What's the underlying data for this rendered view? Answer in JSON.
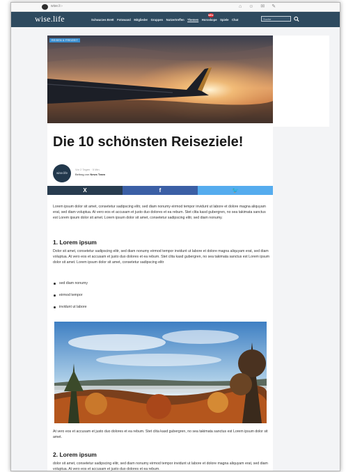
{
  "topbar": {
    "user": "wise.li ›"
  },
  "navbar": {
    "logo": "wise.life",
    "items": [
      {
        "label": "Schwarzes Brett"
      },
      {
        "label": "Fotowand"
      },
      {
        "label": "Mitglieder"
      },
      {
        "label": "Gruppen"
      },
      {
        "label": "Nutzertreffen"
      },
      {
        "label": "Themen"
      },
      {
        "label": "Horoskope"
      },
      {
        "label": "Spiele"
      },
      {
        "label": "Chat"
      }
    ],
    "active_item": "Themen",
    "badge": "NEU",
    "search_placeholder": "Suche"
  },
  "article": {
    "category": "REISEN & FREIZEIT",
    "title": "Die 10 schönsten Reiseziele!",
    "author": {
      "avatar_text": "wise.life",
      "meta": "Vor 2 Tagen · 5 Min.",
      "byline_prefix": "Beitrag von",
      "byline_name": "News Team"
    },
    "share": {
      "x": "X",
      "facebook": "f",
      "twitter": "🐦"
    },
    "intro": "Lorem ipsum dolor sit amet, consetetur sadipscing elitr, sed diam nonumy eirmod tempor invidunt ut labore et dolore magna aliquyam erat, sed diam voluptua. At vero eos et accusam et justo duo dolores et ea rebum. Stet clita kasd gubergren, no sea takimata sanctus est Lorem ipsum dolor sit amet. Lorem ipsum dolor sit amet, consetetur sadipscing elitr, sed diam nonumy.",
    "section1": {
      "heading": "1. Lorem ipsum",
      "text": "Dolor sit amet, consetetur sadipscing elitr, sed diam nonumy eirmod tempor invidunt ut labore et dolore magna aliquyam erat, sed diam voluptua. At vero eos et accusam et justo duo dolores et ea rebum. Stet clita kasd gubergren, no sea takimata sanctus est Lorem ipsum dolor sit amet. Lorem ipsum dolor sit amet, consetetur sadipscing elitr",
      "bullets": [
        "sed diam nonumy",
        "eirmod tempor",
        "invidunt ut labore"
      ]
    },
    "after_image": "At vero eos et accusam et justo duo dolores et ea rebum. Stet clita kasd gubergren, no sea takimata sanctus est Lorem ipsum dolor sit amet.",
    "section2": {
      "heading": "2. Lorem ipsum",
      "text": "dolor sit amet, consetetur sadipscing elitr, sed diam nonumy eirmod tempor invidunt ut labore et dolore magna aliquyam erat, sed diam voluptua. At vero eos et accusam et justo duo dolores et ea rebum."
    }
  },
  "colors": {
    "nav_bg": "#2e4a5f",
    "share_x": "#283c4f",
    "share_facebook": "#3b5fa5",
    "share_twitter": "#55acee",
    "badge": "#d9272e"
  },
  "icons": [
    "avatar",
    "home-icon",
    "people-icon",
    "notification-icon",
    "settings-icon",
    "search-icon",
    "x-logo-icon",
    "facebook-icon",
    "twitter-icon"
  ]
}
